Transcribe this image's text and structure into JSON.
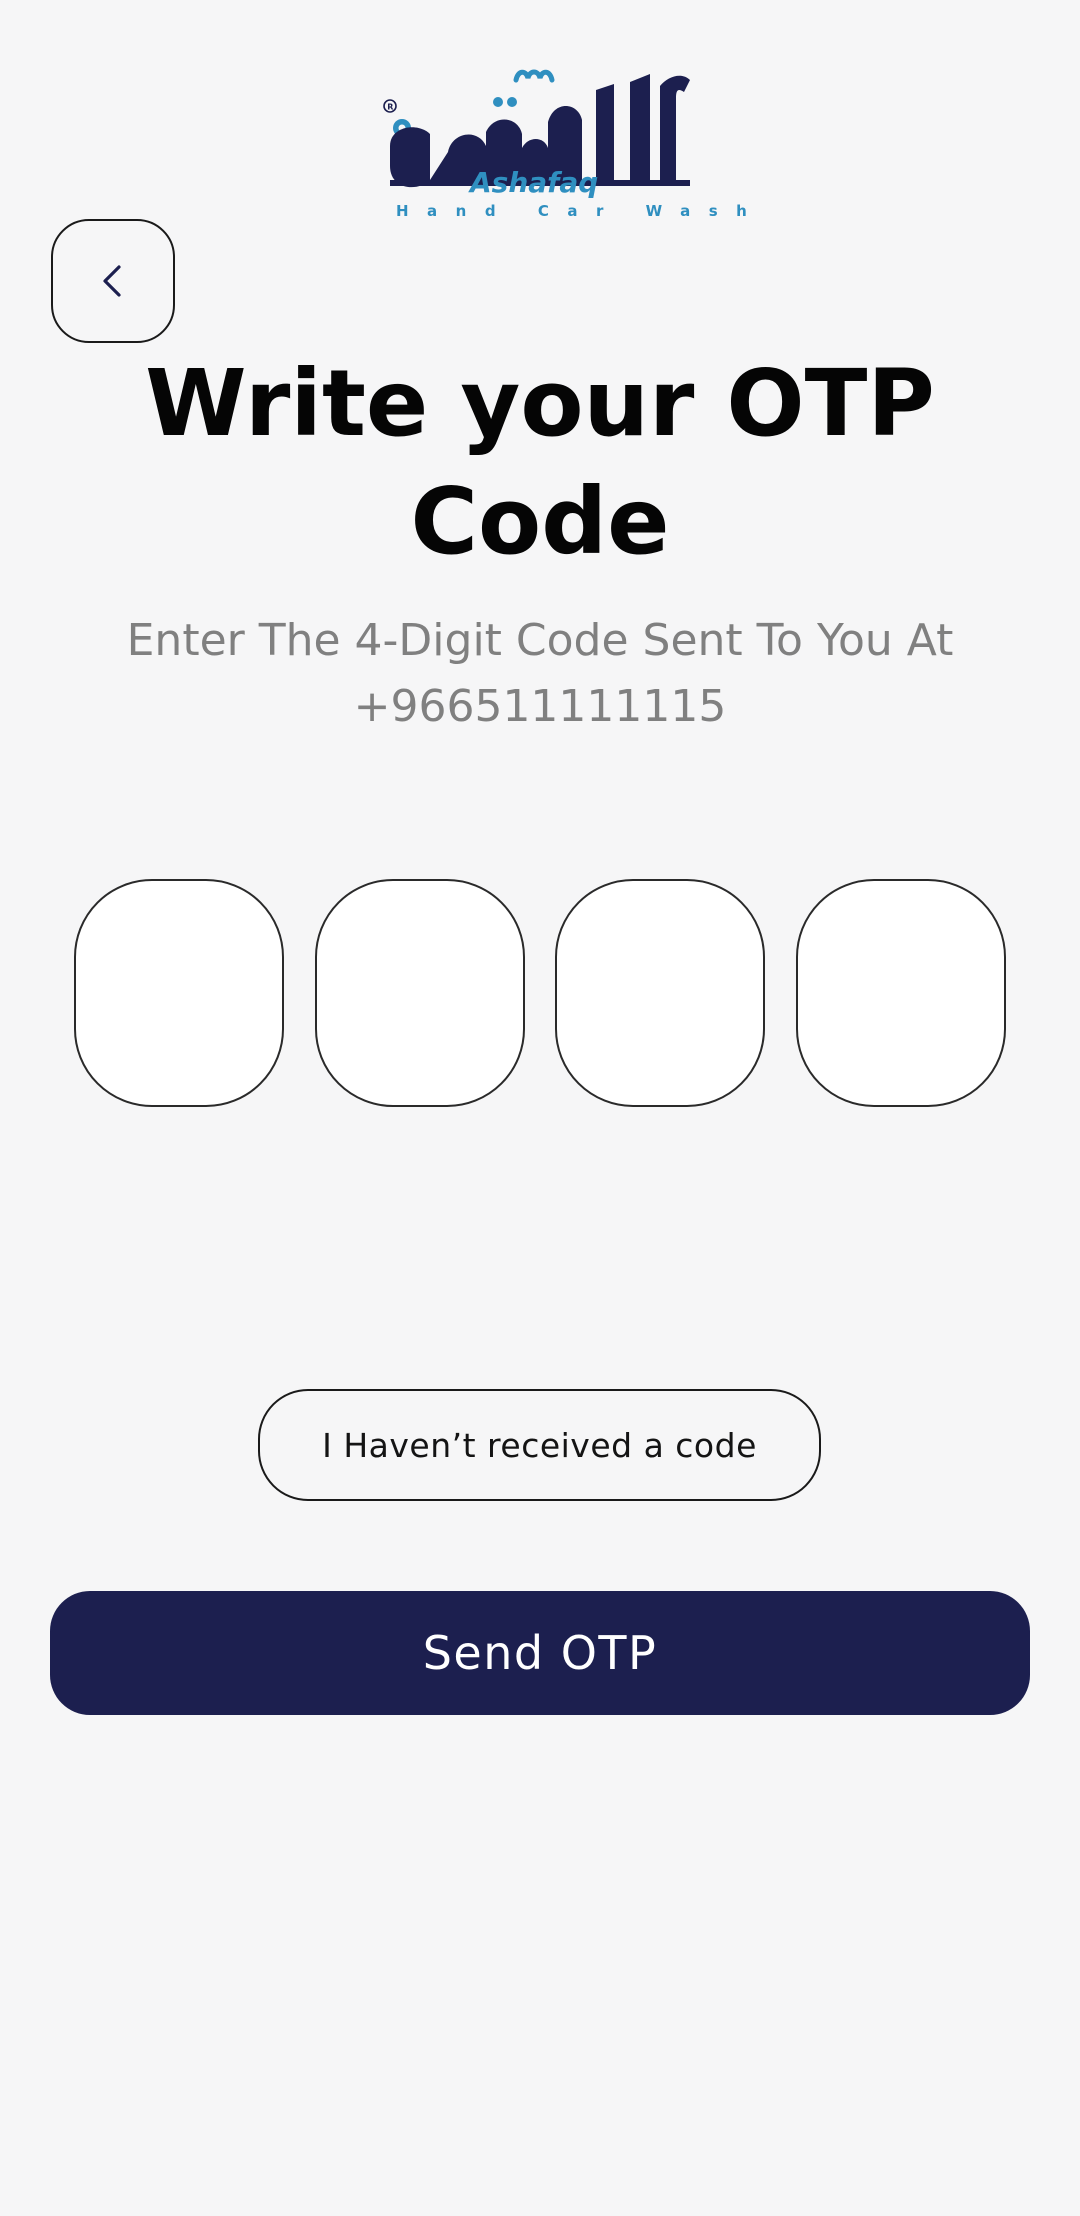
{
  "brand": {
    "logo_arabic": "الشفق",
    "logo_latin": "Ashafaq",
    "tagline": "Hand Car Wash",
    "registered_mark": "®",
    "primary_color": "#1c1f4f",
    "accent_color": "#2f8fc0"
  },
  "header": {
    "back_icon": "chevron-left-icon"
  },
  "main": {
    "title_line1": "Write your OTP",
    "title_line2": "Code",
    "subtitle_line1": "Enter The 4-Digit Code Sent To You At",
    "subtitle_line2": "+966511111115",
    "otp_digits": [
      "",
      "",
      "",
      ""
    ]
  },
  "actions": {
    "resend_label": "I Haven’t received a code",
    "send_label": "Send OTP"
  }
}
